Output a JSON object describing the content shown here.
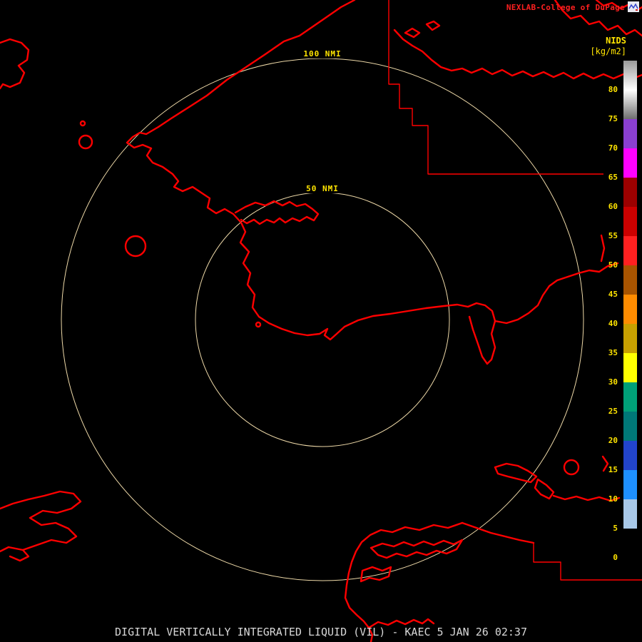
{
  "colors": {
    "background": "#000000",
    "map_outline": "#ff0000",
    "range_ring": "#eed9a8",
    "label_yellow": "#ffe400",
    "header_red": "#ff2020",
    "caption_gray": "#d8d8d8"
  },
  "header": {
    "brand": "NEXLAB-College of DuPage"
  },
  "colorbar": {
    "title": "NIDS",
    "units": "[kg/m2]",
    "ticks": [
      "80",
      "75",
      "70",
      "65",
      "60",
      "55",
      "50",
      "45",
      "40",
      "35",
      "30",
      "25",
      "20",
      "15",
      "10",
      "5",
      "0"
    ],
    "segments": [
      {
        "label": "80+",
        "css": "linear-gradient(180deg,#9a9a9a,#ffffff)"
      },
      {
        "label": "75-80",
        "css": "linear-gradient(180deg,#ffffff,#6e6e6e)"
      },
      {
        "label": "70-75",
        "css": "#8a3fd1"
      },
      {
        "label": "65-70",
        "css": "#ff00ff"
      },
      {
        "label": "60-65",
        "css": "#9c0000"
      },
      {
        "label": "55-60",
        "css": "#cc0000"
      },
      {
        "label": "50-55",
        "css": "#ff2020"
      },
      {
        "label": "45-50",
        "css": "#a85400"
      },
      {
        "label": "40-45",
        "css": "#ff8c00"
      },
      {
        "label": "35-40",
        "css": "#c8a000"
      },
      {
        "label": "30-35",
        "css": "#ffff00"
      },
      {
        "label": "25-30",
        "css": "#00a078"
      },
      {
        "label": "20-25",
        "css": "#007878"
      },
      {
        "label": "15-20",
        "css": "#2244cc"
      },
      {
        "label": "10-15",
        "css": "#1e90ff"
      },
      {
        "label": "5-10",
        "css": "#a8c8e8"
      },
      {
        "label": "0-5",
        "css": "#000000"
      }
    ]
  },
  "range_rings": {
    "outer_label": "100 NMI",
    "inner_label": "50 NMI"
  },
  "footer": {
    "caption": "DIGITAL VERTICALLY INTEGRATED LIQUID (VIL) - KAEC 5 JAN 26 02:37"
  }
}
